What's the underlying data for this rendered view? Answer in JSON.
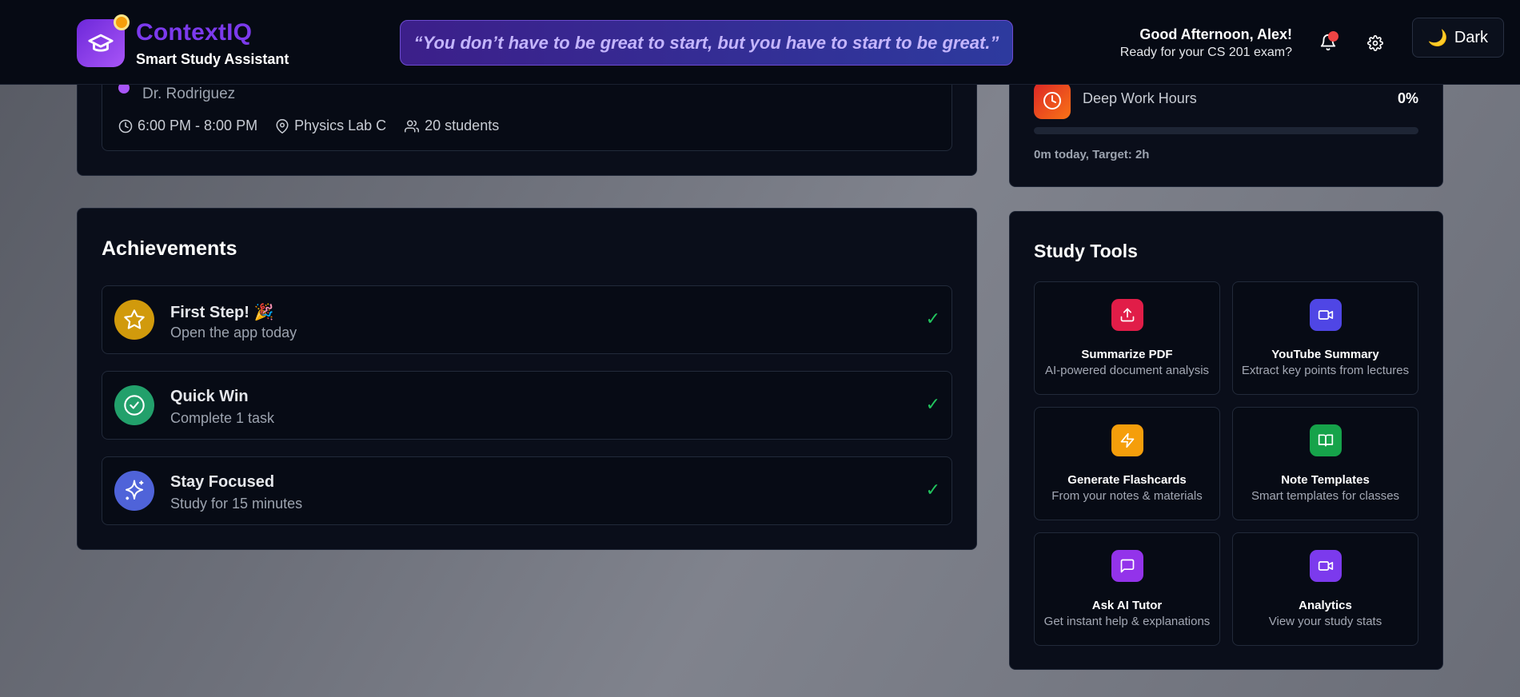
{
  "header": {
    "brand_name": "ContextIQ",
    "brand_sub": "Smart Study Assistant",
    "quote": "“You don’t have to be great to start, but you have to start to be great.”",
    "greeting_title": "Good Afternoon, Alex!",
    "greeting_sub": "Ready for your CS 201 exam?",
    "theme_label": "Dark",
    "icons": [
      "graduation-cap-icon",
      "bell-icon",
      "gear-icon",
      "moon-icon"
    ]
  },
  "class_session": {
    "professor": "Dr. Rodriguez",
    "time": "6:00 PM - 8:00 PM",
    "location": "Physics Lab C",
    "students": "20 students"
  },
  "deep_work": {
    "label": "Deep Work Hours",
    "percent": "0%",
    "progress": 0,
    "subtitle": "0m today, Target: 2h"
  },
  "achievements": {
    "title": "Achievements",
    "items": [
      {
        "title": "First Step! 🎉",
        "desc": "Open the app today",
        "icon": "star-icon",
        "color": "#d19a0c",
        "check": "✓"
      },
      {
        "title": "Quick Win",
        "desc": "Complete 1 task",
        "icon": "check-circle-icon",
        "color": "#22a06b",
        "check": "✓"
      },
      {
        "title": "Stay Focused",
        "desc": "Study for 15 minutes",
        "icon": "sparkle-icon",
        "color": "#4f63d9",
        "check": "✓"
      }
    ]
  },
  "study_tools": {
    "title": "Study Tools",
    "items": [
      {
        "name": "Summarize PDF",
        "desc": "AI-powered document analysis",
        "icon": "upload-icon",
        "color": "#e11d48"
      },
      {
        "name": "YouTube Summary",
        "desc": "Extract key points from lectures",
        "icon": "video-icon",
        "color": "#4f46e5"
      },
      {
        "name": "Generate Flashcards",
        "desc": "From your notes & materials",
        "icon": "lightning-icon",
        "color": "#f59e0b"
      },
      {
        "name": "Note Templates",
        "desc": "Smart templates for classes",
        "icon": "book-icon",
        "color": "#16a34a"
      },
      {
        "name": "Ask AI Tutor",
        "desc": "Get instant help & explanations",
        "icon": "chat-icon",
        "color": "#9333ea"
      },
      {
        "name": "Analytics",
        "desc": "View your study stats",
        "icon": "video-icon",
        "color": "#7c3aed"
      }
    ]
  }
}
